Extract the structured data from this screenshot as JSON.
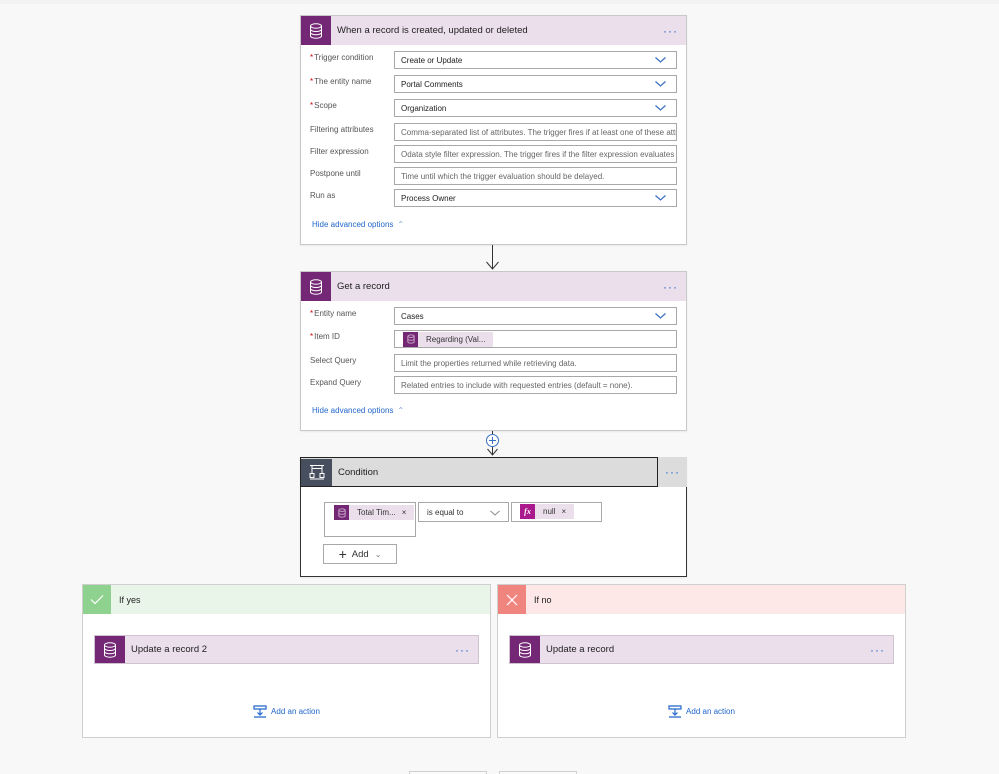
{
  "trigger": {
    "title": "When a record is created, updated or deleted",
    "icon": "database-icon",
    "more": "···",
    "fields": [
      {
        "label": "Trigger condition",
        "required": true,
        "value": "Create or Update",
        "type": "dropdown"
      },
      {
        "label": "The entity name",
        "required": true,
        "value": "Portal Comments",
        "type": "dropdown"
      },
      {
        "label": "Scope",
        "required": true,
        "value": "Organization",
        "type": "dropdown"
      },
      {
        "label": "Filtering attributes",
        "required": false,
        "placeholder": "Comma-separated list of attributes. The trigger fires if at least one of these attr",
        "type": "text"
      },
      {
        "label": "Filter expression",
        "required": false,
        "placeholder": "Odata style filter expression. The trigger fires if the filter expression evaluates tc",
        "type": "text"
      },
      {
        "label": "Postpone until",
        "required": false,
        "placeholder": "Time until which the trigger evaluation should be delayed.",
        "type": "text"
      },
      {
        "label": "Run as",
        "required": false,
        "value": "Process Owner",
        "type": "dropdown"
      }
    ],
    "advanced_link": "Hide advanced options"
  },
  "get_record": {
    "title": "Get a record",
    "icon": "database-icon",
    "more": "···",
    "fields": [
      {
        "label": "Entity name",
        "required": true,
        "value": "Cases",
        "type": "dropdown"
      },
      {
        "label": "Item ID",
        "required": true,
        "token": "Regarding (Val...",
        "type": "token"
      },
      {
        "label": "Select Query",
        "required": false,
        "placeholder": "Limit the properties returned while retrieving data.",
        "type": "text"
      },
      {
        "label": "Expand Query",
        "required": false,
        "placeholder": "Related entries to include with requested entries (default = none).",
        "type": "text"
      }
    ],
    "advanced_link": "Hide advanced options"
  },
  "condition": {
    "title": "Condition",
    "icon": "condition-icon",
    "more": "···",
    "left_token": "Total Tim...",
    "operator": "is equal to",
    "right_token": "null",
    "right_token_icon": "fx-icon",
    "add_label": "Add"
  },
  "branches": {
    "yes": {
      "title": "If yes",
      "action": "Update a record 2",
      "add_action": "Add an action",
      "color": "#8fd18f",
      "bg": "#e9f5e9"
    },
    "no": {
      "title": "If no",
      "action": "Update a record",
      "add_action": "Add an action",
      "color": "#f0857f",
      "bg": "#fde7e7"
    }
  },
  "colors": {
    "accent_purple": "#742774",
    "header_purple_bg": "#ebdfeb",
    "link_blue": "#2266cc",
    "condition_icon": "#474e5d"
  }
}
